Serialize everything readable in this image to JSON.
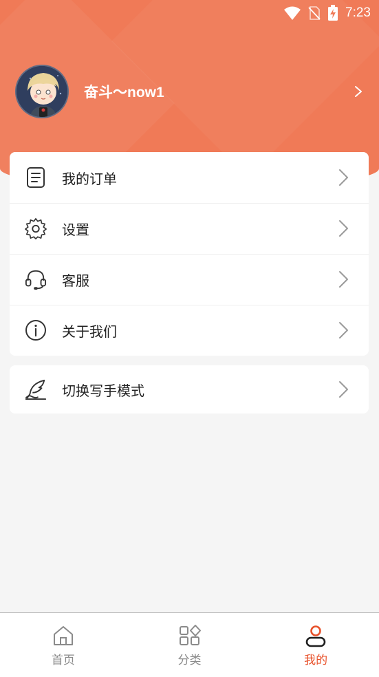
{
  "status_bar": {
    "time": "7:23",
    "icons": [
      "wifi-icon",
      "no-sim-icon",
      "battery-charging-icon"
    ]
  },
  "profile": {
    "username": "奋斗〜now1",
    "avatar_icon": "avatar"
  },
  "menu": {
    "items": [
      {
        "label": "我的订单",
        "icon": "document-icon"
      },
      {
        "label": "设置",
        "icon": "gear-icon"
      },
      {
        "label": "客服",
        "icon": "headset-icon"
      },
      {
        "label": "关于我们",
        "icon": "info-icon"
      }
    ],
    "secondary": [
      {
        "label": "切换写手模式",
        "icon": "quill-icon"
      }
    ]
  },
  "tabs": [
    {
      "label": "首页",
      "icon": "home-icon",
      "active": false
    },
    {
      "label": "分类",
      "icon": "category-icon",
      "active": false
    },
    {
      "label": "我的",
      "icon": "profile-icon",
      "active": true
    }
  ],
  "colors": {
    "accent": "#f07a57",
    "active_tab": "#e8512a",
    "background": "#f5f5f5"
  }
}
